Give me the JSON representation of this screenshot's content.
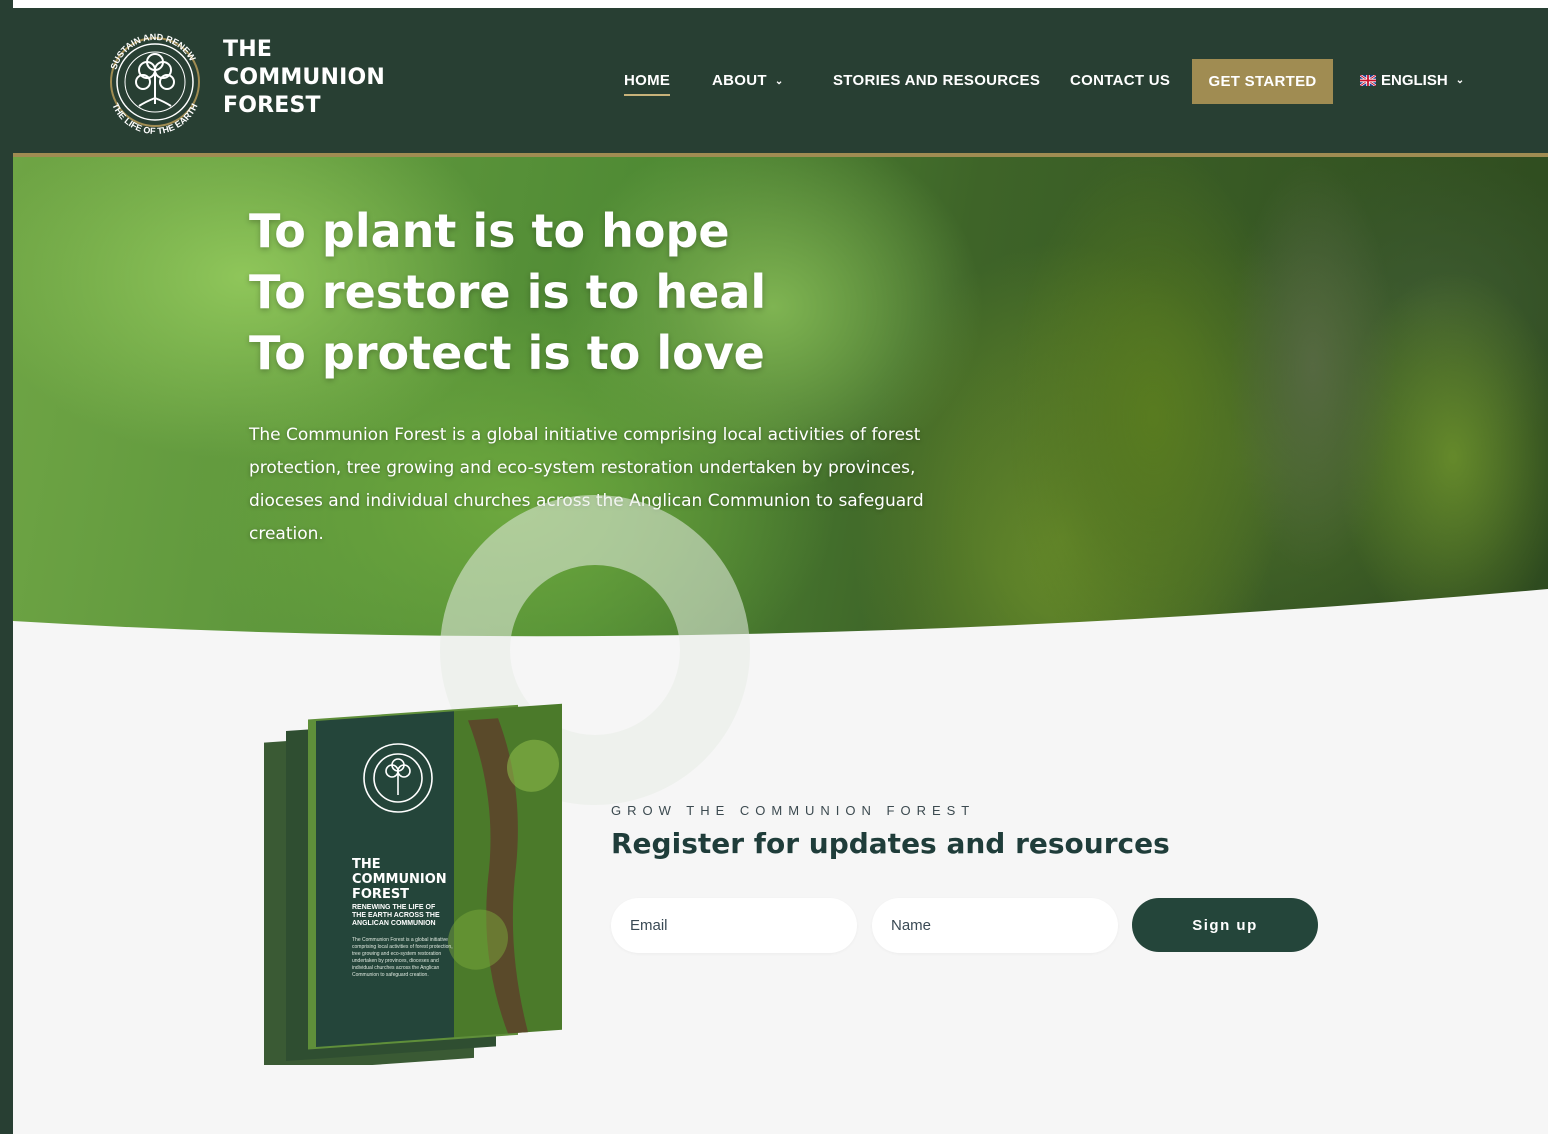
{
  "brand": {
    "name": "THE\nCOMMUNION\nFOREST",
    "logo_ring_text_top": "SUSTAIN AND RENEW",
    "logo_ring_text_bottom": "THE LIFE OF THE EARTH"
  },
  "nav": {
    "items": [
      {
        "label": "HOME",
        "active": true
      },
      {
        "label": "ABOUT",
        "has_dropdown": true
      },
      {
        "label": "STORIES AND RESOURCES"
      },
      {
        "label": "CONTACT US"
      }
    ],
    "cta_label": "GET STARTED",
    "language_label": "ENGLISH"
  },
  "hero": {
    "title_lines": [
      "To plant is to hope",
      "To restore is to heal",
      "To protect is to love"
    ],
    "text": "The Communion Forest is a global initiative comprising local activities of forest protection, tree growing and eco-system restoration undertaken by provinces, dioceses and individual churches across the Anglican Communion to safeguard creation."
  },
  "brochure": {
    "title": "THE\nCOMMUNION\nFOREST",
    "subtitle": "RENEWING THE LIFE OF\nTHE EARTH ACROSS THE\nANGLICAN COMMUNION",
    "body": "The Communion Forest is a global initiative comprising local activities of forest protection, tree growing and eco-system restoration undertaken by provinces, dioceses and individual churches across the Anglican Communion to safeguard creation."
  },
  "signup": {
    "eyebrow": "GROW THE COMMUNION FOREST",
    "heading": "Register for updates and resources",
    "email_placeholder": "Email",
    "name_placeholder": "Name",
    "button_label": "Sign up"
  },
  "colors": {
    "header_bg": "#283f33",
    "accent_gold": "#a08c52",
    "button_dark": "#24453a",
    "heading_color": "#1f3d3a"
  },
  "icons": {
    "logo": "tree-of-life-emblem",
    "dropdown": "chevron-down-icon",
    "flag": "uk-flag-icon"
  }
}
